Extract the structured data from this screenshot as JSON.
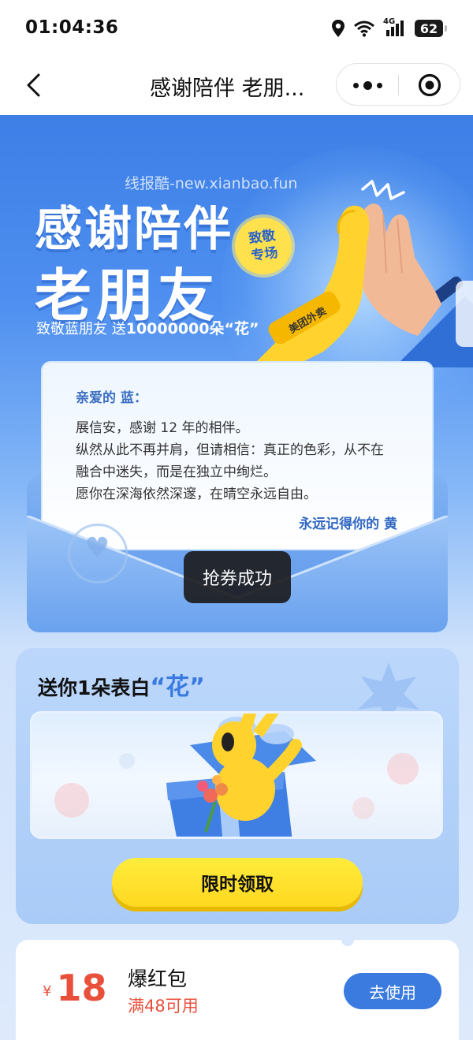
{
  "status_bar": {
    "time": "01:04:36",
    "network": "4G",
    "battery": "62",
    "icons": [
      "location-icon",
      "wifi-icon",
      "signal-icon",
      "battery-icon"
    ]
  },
  "nav": {
    "title": "感谢陪伴 老朋...",
    "icons": [
      "back-icon",
      "more-icon",
      "close-target-icon"
    ]
  },
  "hero": {
    "watermark": "线报酷-new.xianbao.fun",
    "title_line1": "感谢陪伴",
    "title_line2": "老朋友",
    "subtitle_prefix": "致敬蓝朋友 送",
    "subtitle_count": "10000000朵“花”",
    "badge_line1": "致敬",
    "badge_line2": "专场",
    "wristband_text": "美团外卖"
  },
  "letter": {
    "greeting": "亲爱的 蓝：",
    "lines": [
      "展信安，感谢 12 年的相伴。",
      "纵然从此不再并肩，但请相信：真正的色彩，从不在",
      "融合中迷失，而是在独立中绚烂。",
      "愿你在深海依然深邃，在晴空永远自由。"
    ],
    "signature": "永远记得你的 黄"
  },
  "toast": {
    "text": "抢券成功"
  },
  "gift_card": {
    "title_prefix": "送你1朵表白",
    "title_quote": "“花”",
    "button_label": "限时领取"
  },
  "coupon": {
    "currency": "¥",
    "amount": "18",
    "name": "爆红包",
    "condition": "满48可用",
    "button_label": "去使用"
  },
  "colors": {
    "brand_blue": "#3b7be0",
    "brand_yellow": "#ffd820",
    "accent_red": "#e8503b"
  }
}
